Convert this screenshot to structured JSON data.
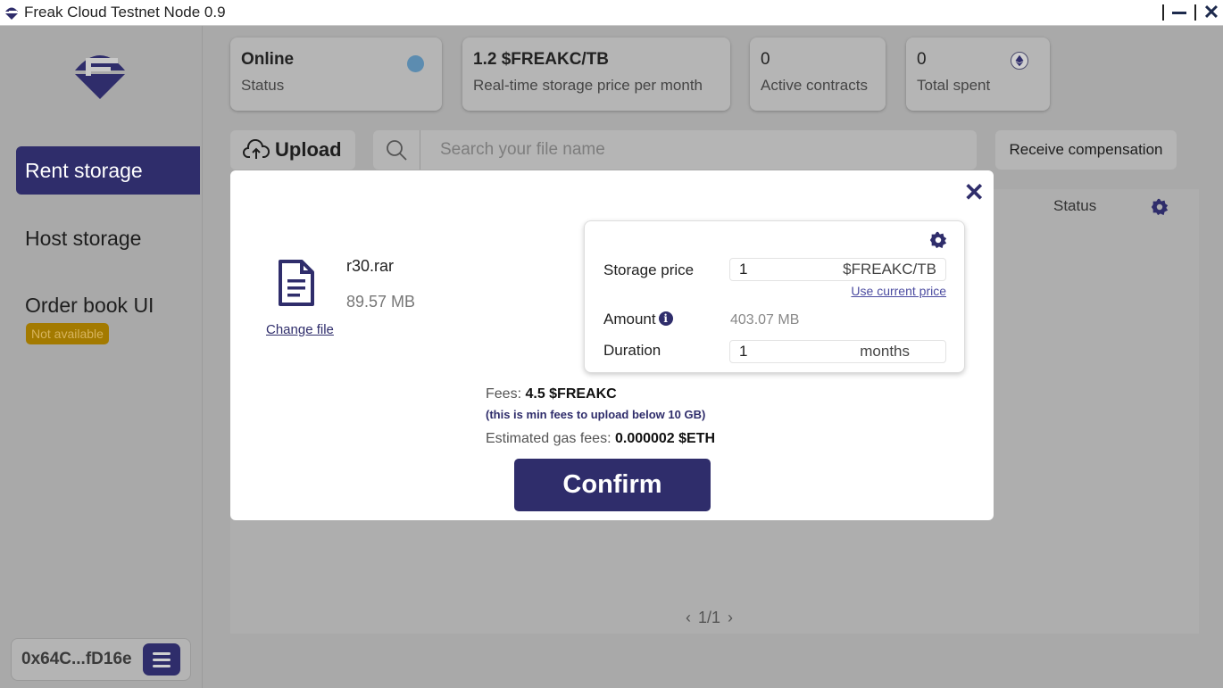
{
  "window": {
    "title": "Freak Cloud Testnet Node 0.9"
  },
  "sidebar": {
    "items": [
      {
        "label": "Rent storage"
      },
      {
        "label": "Host storage"
      },
      {
        "label": "Order book UI",
        "badge": "Not available"
      }
    ],
    "wallet": {
      "address": "0x64C...fD16e"
    }
  },
  "stats": {
    "status": {
      "value": "Online",
      "label": "Status"
    },
    "price": {
      "value": "1.2 $FREAKC/TB",
      "label": "Real-time storage price per month"
    },
    "contracts": {
      "value": "0",
      "label": "Active contracts"
    },
    "spent": {
      "value": "0",
      "label": "Total spent"
    }
  },
  "toolbar": {
    "upload_label": "Upload",
    "search_placeholder": "Search your file name",
    "receive_label": "Receive compensation"
  },
  "table": {
    "status_header": "Status",
    "pagination": "1/1"
  },
  "modal": {
    "file_name": "r30.rar",
    "file_size": "89.57 MB",
    "change_file": "Change file",
    "storage_price_label": "Storage price",
    "storage_price_value": "1",
    "storage_price_unit": "$FREAKC/TB",
    "use_current_price": "Use current price",
    "amount_label": "Amount",
    "amount_value": "403.07 MB",
    "duration_label": "Duration",
    "duration_value": "1",
    "duration_unit": "months",
    "fees_label": "Fees:",
    "fees_value": "4.5 $FREAKC",
    "fees_note": "(this is min fees to upload below 10 GB)",
    "gas_label": "Estimated gas fees:",
    "gas_value": "0.000002 $ETH",
    "confirm_label": "Confirm"
  },
  "colors": {
    "accent": "#2f2d6b",
    "badge": "#a37a00",
    "status_dot": "#5c8cb0"
  }
}
